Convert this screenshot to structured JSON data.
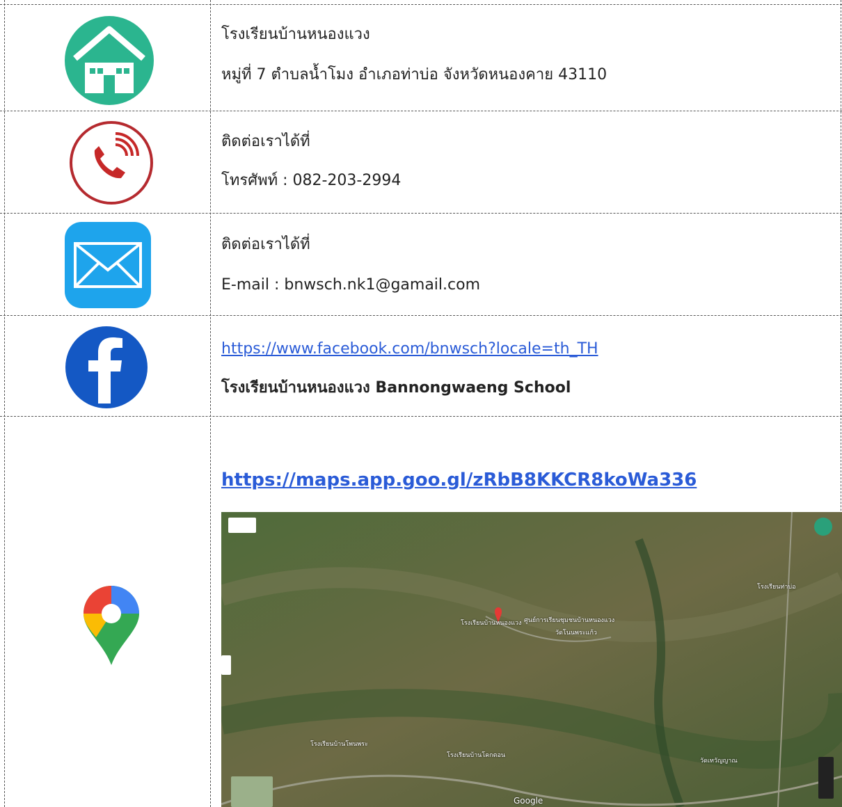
{
  "rows": [
    {
      "icon": "home-icon",
      "line1": "โรงเรียนบ้านหนองแวง",
      "line2": "หมู่ที่ 7  ตำบลน้ำโมง  อำเภอท่าบ่อ  จังหวัดหนองคาย  43110"
    },
    {
      "icon": "phone-icon",
      "line1": "ติดต่อเราได้ที่",
      "line2": "โทรศัพท์  :  082-203-2994"
    },
    {
      "icon": "mail-icon",
      "line1": "ติดต่อเราได้ที่",
      "line2": "E-mail  :  bnwsch.nk1@gamail.com"
    },
    {
      "icon": "facebook-icon",
      "line1": "https://www.facebook.com/bnwsch?locale=th_TH",
      "line2": "โรงเรียนบ้านหนองแวง Bannongwaeng School"
    },
    {
      "icon": "google-maps-icon",
      "line1": "https://maps.app.goo.gl/zRbB8KKCR8koWa336"
    }
  ],
  "map": {
    "labels": [
      "โรงเรียนบ้านหนองแวง",
      "ศูนย์การเรียนชุมชนบ้านหนองแวง",
      "วัดโนนพระแก้ว",
      "โรงเรียนบ้านโพนพระ",
      "โรงเรียนบ้านโคกตอน",
      "โรงเรียนท่าบ่อ",
      "วัดเทวัญญาณ",
      "Google"
    ],
    "colors": {
      "accent": "#e53935",
      "icon_bg": "#2bb58f",
      "mail_bg": "#1ea4ec",
      "fb_bg": "#1458c4"
    }
  }
}
